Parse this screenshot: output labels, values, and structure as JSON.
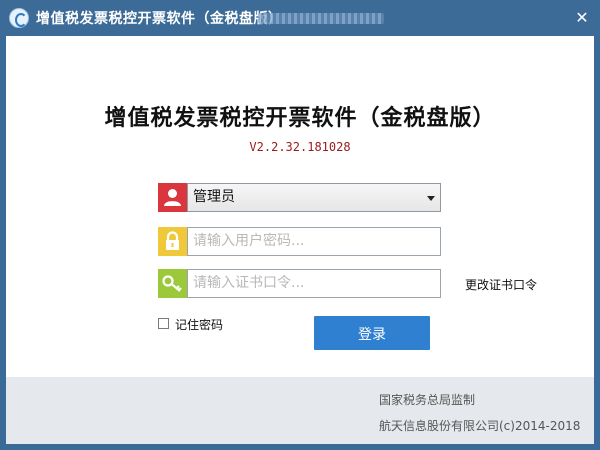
{
  "window": {
    "title": "增值税发票税控开票软件（金税盘版）",
    "close_glyph": "✕"
  },
  "main": {
    "title": "增值税发票税控开票软件（金税盘版）",
    "version": "V2.2.32.181028"
  },
  "form": {
    "user_select": {
      "value": "管理员",
      "icon": "user-icon"
    },
    "password": {
      "placeholder": "请输入用户密码...",
      "icon": "lock-icon"
    },
    "cert_password": {
      "placeholder": "请输入证书口令...",
      "icon": "key-icon"
    },
    "change_cert_label": "更改证书口令",
    "remember_label": "记住密码",
    "remember_checked": false,
    "login_label": "登录"
  },
  "footer": {
    "line1": "国家税务总局监制",
    "line2": "航天信息股份有限公司(c)2014-2018"
  },
  "colors": {
    "titlebar": "#3d6b97",
    "user_icon_bg": "#d9363e",
    "lock_icon_bg": "#f0c93a",
    "key_icon_bg": "#9cc93b",
    "login_button": "#2f80d0",
    "version_text": "#9a1a1a"
  }
}
